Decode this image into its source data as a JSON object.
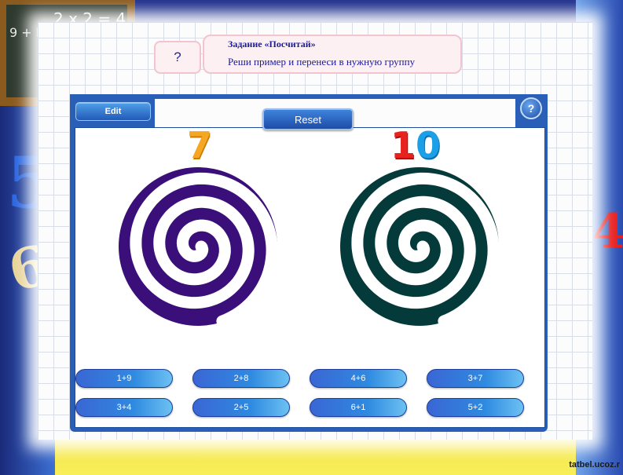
{
  "background": {
    "chalkboard_text": [
      "2 x 2 = 4",
      "9 + L"
    ],
    "watermark": "tatbel.ucoz.r"
  },
  "task": {
    "help_symbol": "?",
    "title": "Задание «Посчитай»",
    "instruction": "Реши пример и перенеси в нужную группу"
  },
  "toolbar": {
    "edit_label": "Edit",
    "reset_label": "Reset",
    "help_label": "?"
  },
  "groups": [
    {
      "number": "7",
      "color": "#3b0f7a",
      "icon": "spiral-icon"
    },
    {
      "number_digits": [
        "1",
        "0"
      ],
      "color": "#053a3a",
      "icon": "spiral-icon"
    }
  ],
  "cards": {
    "row1": [
      "1+9",
      "2+8",
      "4+6",
      "3+7"
    ],
    "row2": [
      "3+4",
      "2+5",
      "6+1",
      "5+2"
    ]
  },
  "colors": {
    "frame": "#2a5fb8",
    "card": "#2f8ae0",
    "accent_orange": "#f5a623",
    "accent_red": "#e8231f",
    "accent_cyan": "#1ba0e8"
  }
}
